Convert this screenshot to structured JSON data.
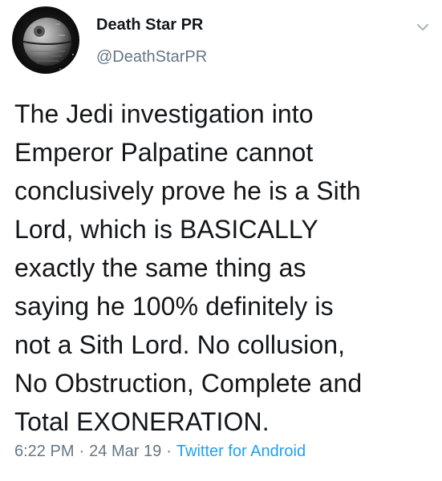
{
  "tweet": {
    "display_name": "Death Star PR",
    "handle": "@DeathStarPR",
    "body_lines": [
      "The Jedi investigation into",
      "Emperor Palpatine cannot",
      "conclusively prove he is a Sith",
      "Lord, which is BASICALLY",
      "exactly the same thing as",
      "saying he 100% definitely is",
      "not a Sith Lord. No collusion,",
      "No Obstruction, Complete and",
      "Total EXONERATION."
    ],
    "time": "6:22 PM",
    "separator": "·",
    "date": "24 Mar 19",
    "source": "Twitter for Android"
  },
  "icons": {
    "avatar": "death-star-avatar",
    "caret": "chevron-down-icon"
  },
  "colors": {
    "text_primary": "#14171a",
    "text_secondary": "#657786",
    "link": "#1da1f2"
  }
}
